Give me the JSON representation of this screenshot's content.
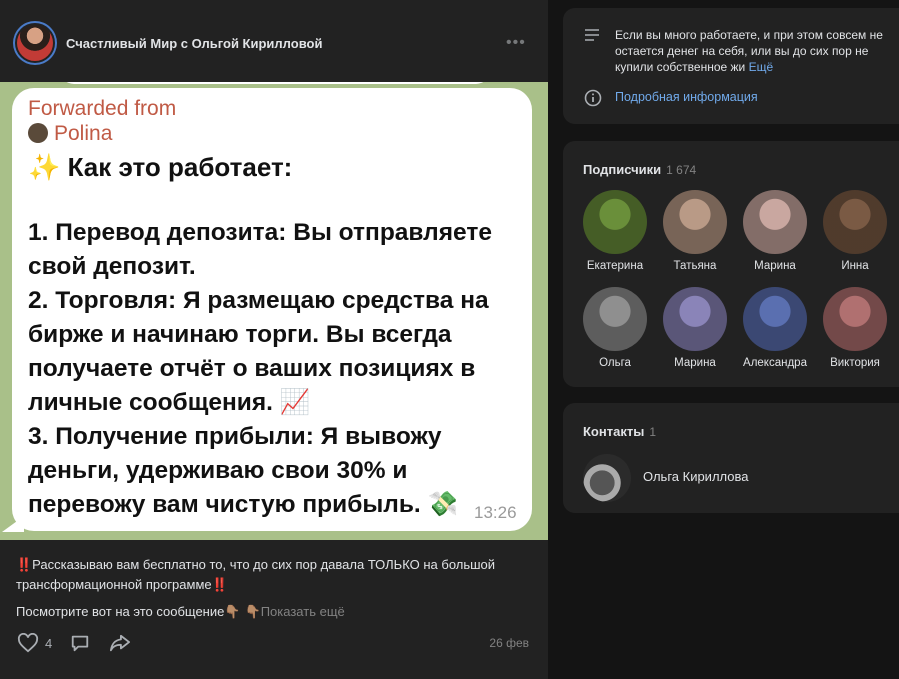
{
  "header": {
    "group_name": "Счастливый Мир с Ольгой Кирилловой",
    "more_icon": "more-dots-icon"
  },
  "message": {
    "forwarded_label": "Forwarded from",
    "forwarded_user": "Polina",
    "title": "✨ Как это работает:",
    "body": "1. Перевод депозита: Вы отправляете свой депозит.\n2. Торговля: Я размещаю средства на бирже и начинаю торги. Вы всегда получаете отчёт о ваших позициях в личные сообщения. 📈\n3. Получение прибыли: Я вывожу деньги, удерживаю свои 30% и перевожу вам чистую прибыль. 💸",
    "time": "13:26"
  },
  "post": {
    "text": "‼️Рассказываю вам бесплатно то, что до сих пор давала ТОЛЬКО на большой трансформационной программе‼️",
    "text2": "Посмотрите вот на это сообщение👇🏽",
    "show_more": "👇🏽Показать ещё",
    "likes": "4",
    "date": "26 фев"
  },
  "about": {
    "text": "Если вы много работаете, и при этом совсем не остается денег на себя, или вы до сих пор не купили собственное жи",
    "more": "Ещё",
    "info_link": "Подробная информация"
  },
  "subscribers": {
    "title": "Подписчики",
    "count": "1 674",
    "items": [
      {
        "name": "Екатерина",
        "color": "#6a8f3a"
      },
      {
        "name": "Татьяна",
        "color": "#b99a86"
      },
      {
        "name": "Марина",
        "color": "#c9a7a0"
      },
      {
        "name": "Инна",
        "color": "#7a5a44"
      },
      {
        "name": "Ольга",
        "color": "#8f8f8f"
      },
      {
        "name": "Марина",
        "color": "#8a84b8"
      },
      {
        "name": "Александра",
        "color": "#5a6fb0"
      },
      {
        "name": "Виктория",
        "color": "#b07070"
      }
    ]
  },
  "contacts": {
    "title": "Контакты",
    "count": "1",
    "name": "Ольга Кириллова"
  }
}
